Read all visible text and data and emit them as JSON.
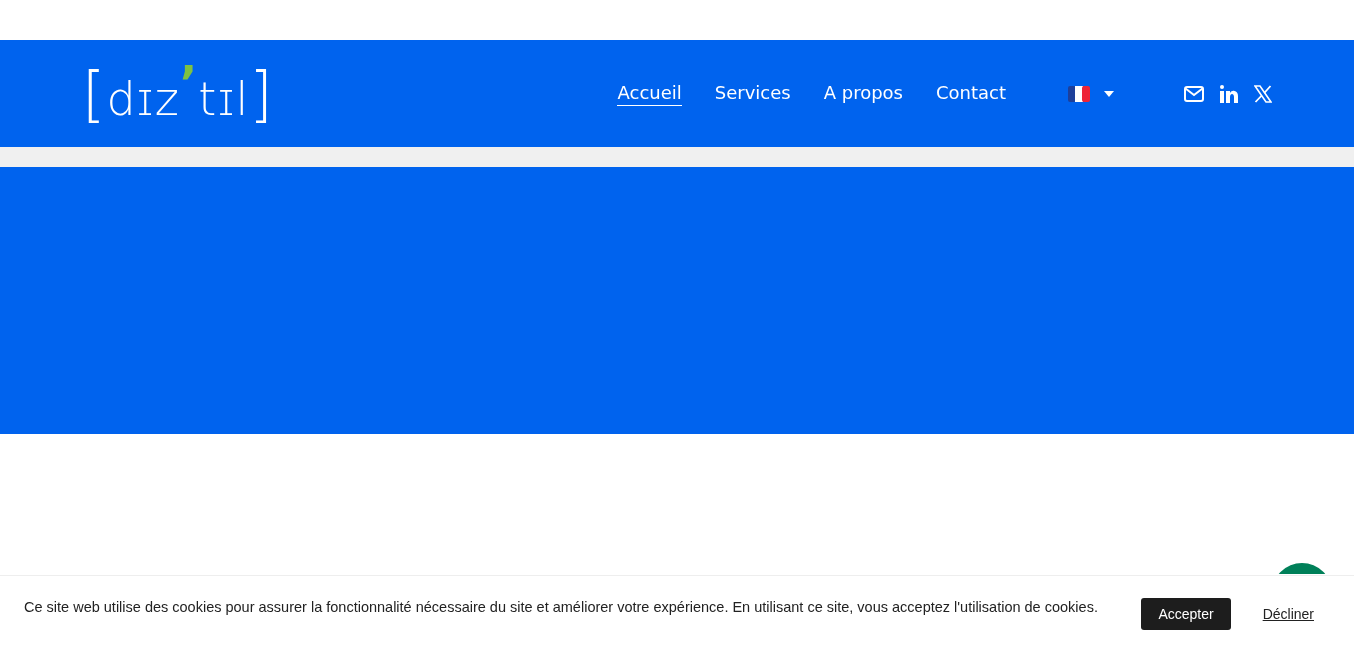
{
  "logo": {
    "open": "[",
    "part_1": "dɪz",
    "accent": "’",
    "part_2": "tɪl",
    "close": "]"
  },
  "nav": [
    {
      "label": "Accueil",
      "selected": true
    },
    {
      "label": "Services",
      "selected": false
    },
    {
      "label": "A propos",
      "selected": false
    },
    {
      "label": "Contact",
      "selected": false
    }
  ],
  "social": [
    {
      "kind": "mail"
    },
    {
      "kind": "linkedin"
    },
    {
      "kind": "x"
    }
  ],
  "cookie_bar": {
    "message": "Ce site web utilise des cookies pour assurer la fonctionnalité nécessaire du site et améliorer votre expérience. En utilisant ce site, vous acceptez l'utilisation de cookies.",
    "accept": "Accepter",
    "decline": "Décliner"
  }
}
